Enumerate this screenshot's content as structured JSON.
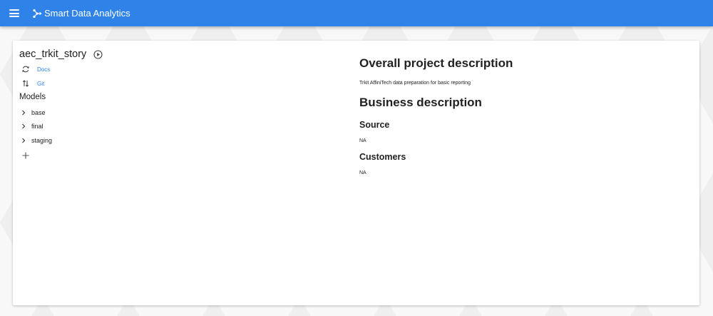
{
  "header": {
    "app_title": "Smart Data Analytics",
    "menu_icon": "hamburger-menu-icon",
    "logo_icon": "data-flow-logo-icon",
    "color": "#2f83e8"
  },
  "project": {
    "name": "aec_trkit_story",
    "run_icon": "play-circle-icon",
    "links": [
      {
        "label": "Docs",
        "icon": "sync-icon"
      },
      {
        "label": "Git",
        "icon": "swap-vertical-icon"
      }
    ],
    "models_label": "Models",
    "models": [
      "base",
      "final",
      "staging"
    ],
    "add_icon": "plus-icon"
  },
  "description": {
    "overall_heading": "Overall project description",
    "overall_text": "Trkit AffiniTech data preparation for basic reporting",
    "business_heading": "Business description",
    "source_heading": "Source",
    "source_text": "NA",
    "customers_heading": "Customers",
    "customers_text": "NA"
  }
}
